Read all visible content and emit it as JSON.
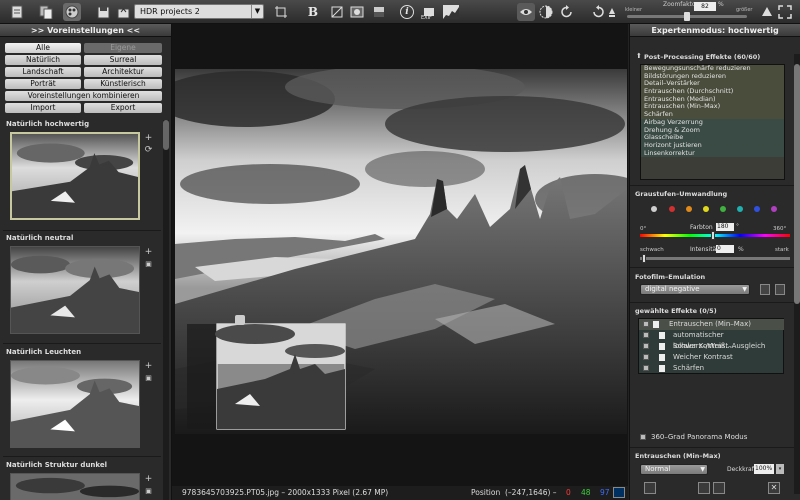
{
  "toolbar": {
    "project_name": "HDR projects 2",
    "zoom_label": "Zoomfaktor",
    "zoom_value": "82",
    "zoom_unit": "%",
    "zoom_small": "kleiner",
    "zoom_big": "größer",
    "zoom_fraction": 0.5,
    "exif_label": "EXIF",
    "info_label": "i",
    "bold_label": "B"
  },
  "left": {
    "header": ">> Voreinstellungen <<",
    "filters": [
      "Alle",
      "Eigene",
      "Natürlich",
      "Surreal",
      "Landschaft",
      "Architektur",
      "Porträt",
      "Künstlerisch"
    ],
    "combine": "Voreinstellungen kombinieren",
    "import": "Import",
    "export": "Export",
    "presets": [
      "Natürlich hochwertig",
      "Natürlich neutral",
      "Natürlich Leuchten",
      "Natürlich Struktur dunkel"
    ]
  },
  "status": {
    "filename": "9783645703925.PT05.jpg – 2000x1333 Pixel (2.67 MP)",
    "position": "Position",
    "coords": "(–247,1646) –",
    "r": "0",
    "g": "48",
    "b": "97"
  },
  "right": {
    "header": "Expertenmodus: hochwertig",
    "post_title": "Post–Processing Effekte (60/60)",
    "post_items": [
      "Bewegungsunschärfe reduzieren",
      "Bildstörungen reduzieren",
      "Detail–Verstärker",
      "Entrauschen (Durchschnitt)",
      "Entrauschen (Median)",
      "Entrauschen (Min–Max)",
      "Schärfen",
      "Airbag Verzerrung",
      "Drehung & Zoom",
      "Glasscheibe",
      "Horizont justieren",
      "Linsenkorrektur"
    ],
    "gray_title": "Graustufen–Umwandlung",
    "hue_label": "Farbton",
    "hue_value": "180",
    "hue_unit": "°",
    "hue_min": "0°",
    "hue_max": "360°",
    "weak": "schwach",
    "strong": "stark",
    "intensity_label": "Intensität",
    "intensity_value": "0",
    "intensity_unit": "%",
    "film_title": "Fotofilm–Emulation",
    "film_value": "digital negative",
    "chosen_title": "gewählte Effekte (0/5)",
    "chosen_items": [
      "Entrauschen (Min–Max)",
      "automatischer Schwarz–/Weiß...",
      "lokaler Kontrast–Ausgleich",
      "Weicher Kontrast",
      "Schärfen"
    ],
    "panorama": "360–Grad Panorama Modus",
    "denoise_title": "Entrauschen (Min–Max)",
    "blend_value": "Normal",
    "opacity_label": "Deckkraft",
    "opacity_value": "100%"
  },
  "colors": {
    "dots": [
      "#cfcfcf",
      "#d03030",
      "#e08a1a",
      "#e0d81c",
      "#40b040",
      "#20b0b0",
      "#3050e0",
      "#b040c0"
    ]
  }
}
